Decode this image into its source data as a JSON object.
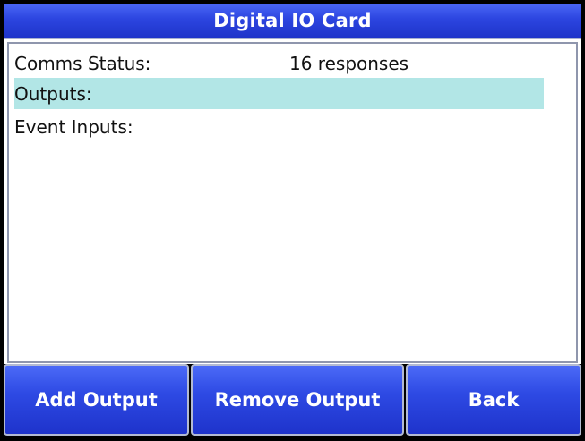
{
  "window": {
    "title": "Digital IO Card"
  },
  "rows": [
    {
      "label": "Comms Status:",
      "value": "16 responses"
    },
    {
      "label": "Outputs:",
      "value": ""
    },
    {
      "label": "Event Inputs:",
      "value": ""
    }
  ],
  "selected_row": "Outputs:",
  "buttons": {
    "add_output": "Add Output",
    "remove_output": "Remove Output",
    "back": "Back"
  },
  "colors": {
    "titlebar": "#2c45e0",
    "button": "#2e4ae4",
    "highlight": "#b2e6e6",
    "frame": "#000000"
  }
}
